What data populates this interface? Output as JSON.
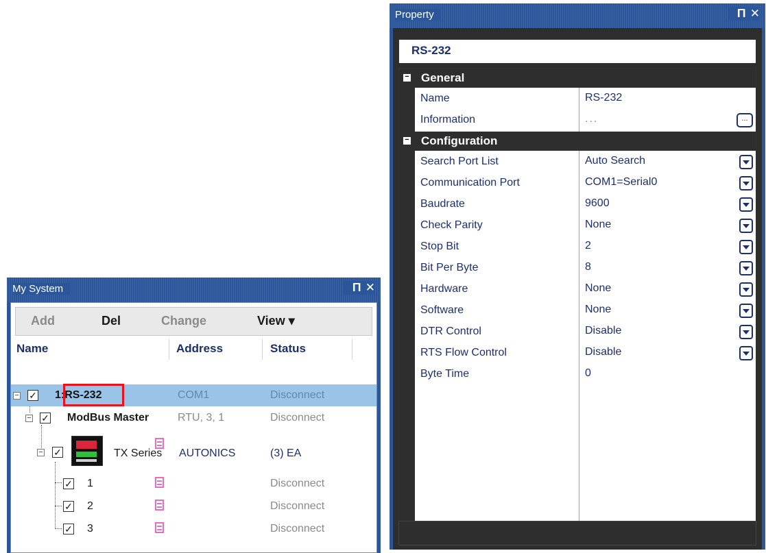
{
  "my_system": {
    "title": "My System",
    "pin_icon": "pin-icon",
    "close_icon": "close-icon",
    "toolbar": {
      "add": "Add",
      "del": "Del",
      "change": "Change",
      "view": "View ▾"
    },
    "columns": {
      "name": "Name",
      "address": "Address",
      "status": "Status"
    },
    "rows": [
      {
        "name": "1:RS-232",
        "address": "COM1",
        "status": "Disconnect",
        "selected": true
      },
      {
        "name": "ModBus Master",
        "address": "RTU, 3, 1",
        "status": "Disconnect"
      },
      {
        "name": "TX Series",
        "address": "AUTONICS",
        "status": "(3) EA"
      },
      {
        "name": "1",
        "address": "",
        "status": "Disconnect"
      },
      {
        "name": "2",
        "address": "",
        "status": "Disconnect"
      },
      {
        "name": "3",
        "address": "",
        "status": "Disconnect"
      }
    ]
  },
  "property": {
    "title": "Property",
    "object_name": "RS-232",
    "categories": [
      {
        "label": "General",
        "items": [
          {
            "key": "Name",
            "value": "RS-232"
          },
          {
            "key": "Information",
            "value": "...",
            "button": "ellipsis"
          }
        ]
      },
      {
        "label": "Configuration",
        "items": [
          {
            "key": "Search Port List",
            "value": "Auto Search",
            "button": "dropdown"
          },
          {
            "key": "Communication Port",
            "value": "COM1=Serial0",
            "button": "dropdown"
          },
          {
            "key": "Baudrate",
            "value": "9600",
            "button": "dropdown"
          },
          {
            "key": "Check Parity",
            "value": "None",
            "button": "dropdown"
          },
          {
            "key": "Stop Bit",
            "value": "2",
            "button": "dropdown"
          },
          {
            "key": "Bit Per Byte",
            "value": "8",
            "button": "dropdown"
          },
          {
            "key": "Hardware",
            "value": "None",
            "button": "dropdown"
          },
          {
            "key": "Software",
            "value": "None",
            "button": "dropdown"
          },
          {
            "key": "DTR Control",
            "value": "Disable",
            "button": "dropdown"
          },
          {
            "key": "RTS Flow Control",
            "value": "Disable",
            "button": "dropdown"
          },
          {
            "key": "Byte Time",
            "value": "0"
          }
        ]
      }
    ]
  }
}
